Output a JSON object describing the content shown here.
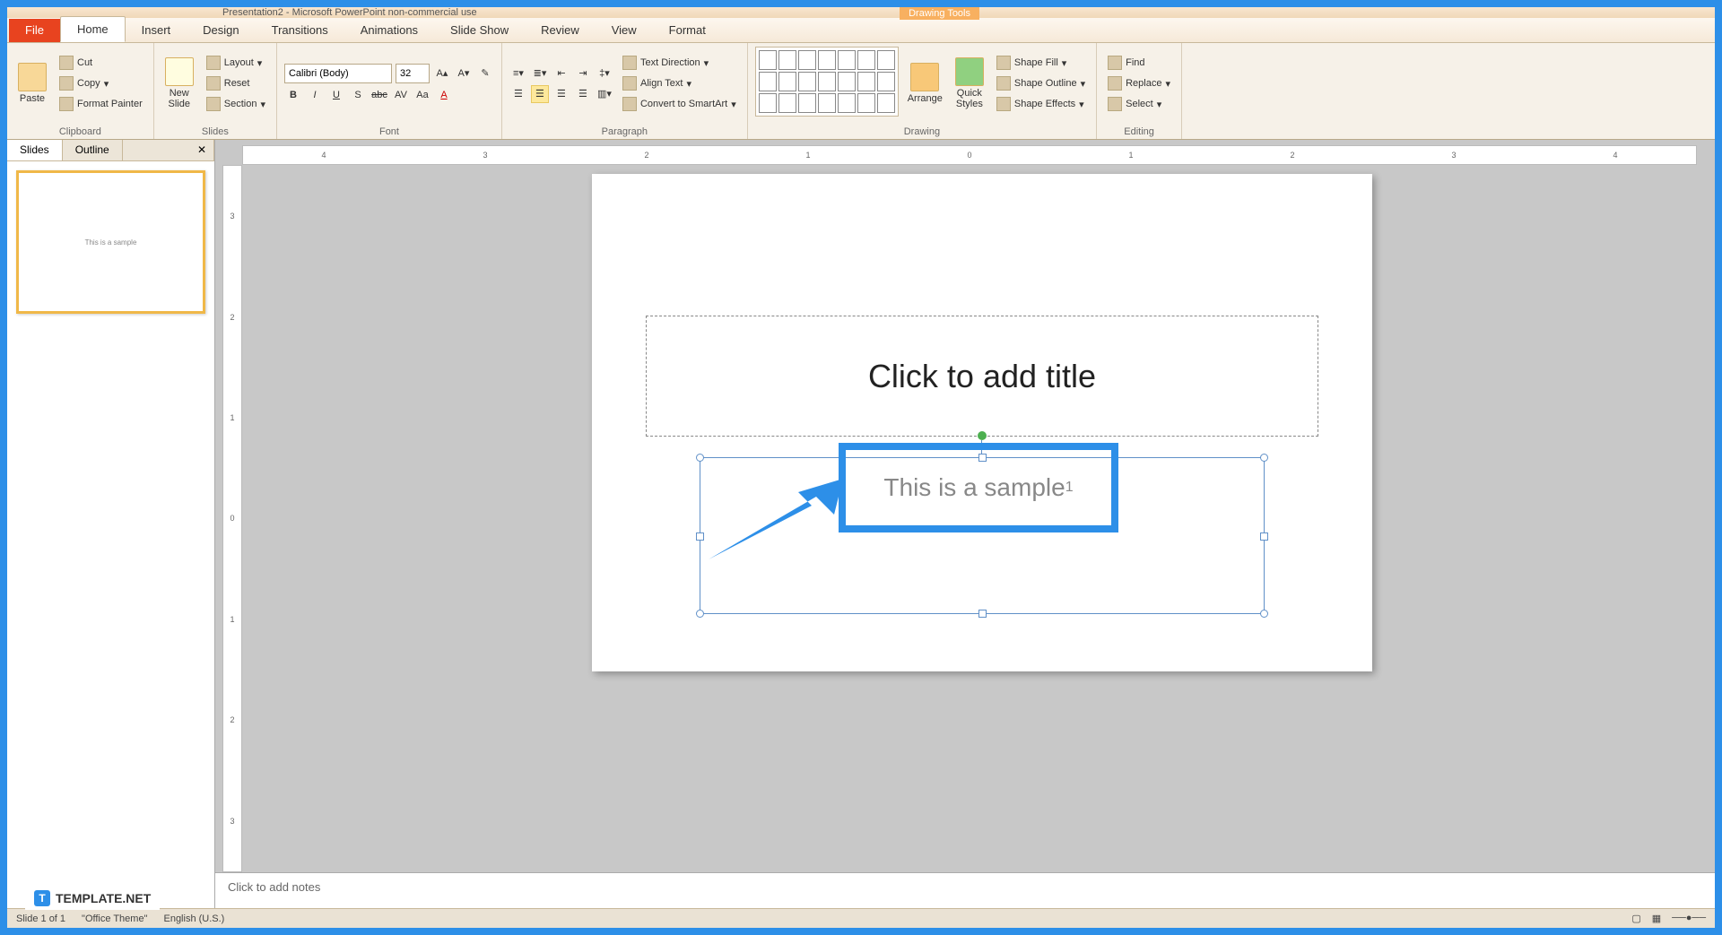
{
  "titlebar": "Presentation2 - Microsoft PowerPoint non-commercial use",
  "context_tab": "Drawing Tools",
  "tabs": {
    "file": "File",
    "home": "Home",
    "insert": "Insert",
    "design": "Design",
    "transitions": "Transitions",
    "animations": "Animations",
    "slideshow": "Slide Show",
    "review": "Review",
    "view": "View",
    "format": "Format"
  },
  "ribbon": {
    "clipboard": {
      "label": "Clipboard",
      "paste": "Paste",
      "cut": "Cut",
      "copy": "Copy",
      "format_painter": "Format Painter"
    },
    "slides": {
      "label": "Slides",
      "new_slide": "New\nSlide",
      "layout": "Layout",
      "reset": "Reset",
      "section": "Section"
    },
    "font": {
      "label": "Font",
      "family": "Calibri (Body)",
      "size": "32",
      "b": "B",
      "i": "I",
      "u": "U",
      "s": "S",
      "abc": "abc",
      "av": "AV",
      "aa": "Aa",
      "a": "A"
    },
    "paragraph": {
      "label": "Paragraph",
      "text_direction": "Text Direction",
      "align_text": "Align Text",
      "convert_smartart": "Convert to SmartArt"
    },
    "drawing": {
      "label": "Drawing",
      "arrange": "Arrange",
      "quick_styles": "Quick\nStyles",
      "shape_fill": "Shape Fill",
      "shape_outline": "Shape Outline",
      "shape_effects": "Shape Effects"
    },
    "editing": {
      "label": "Editing",
      "find": "Find",
      "replace": "Replace",
      "select": "Select"
    }
  },
  "pane": {
    "slides": "Slides",
    "outline": "Outline",
    "thumb_text": "This is a sample"
  },
  "ruler_h": [
    "4",
    "3",
    "2",
    "1",
    "0",
    "1",
    "2",
    "3",
    "4"
  ],
  "ruler_v": [
    "3",
    "2",
    "1",
    "0",
    "1",
    "2",
    "3"
  ],
  "slide": {
    "title_placeholder": "Click to add title",
    "content_text": "This is a sample",
    "subscript": "1"
  },
  "notes_placeholder": "Click to add notes",
  "status": {
    "slide": "Slide 1 of 1",
    "theme": "\"Office Theme\"",
    "lang": "English (U.S.)"
  },
  "watermark": "TEMPLATE.NET"
}
